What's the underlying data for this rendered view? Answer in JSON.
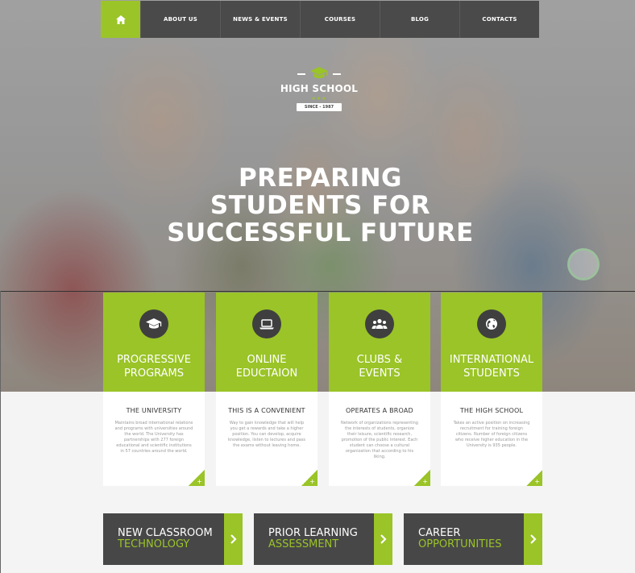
{
  "nav": {
    "home_icon": "home-icon",
    "items": [
      "ABOUT US",
      "NEWS & EVENTS",
      "COURSES",
      "BLOG",
      "CONTACTS"
    ]
  },
  "logo": {
    "name": "HIGH SCHOOL",
    "stars": "★★★",
    "since": "SINCE - 1987"
  },
  "hero": {
    "headline": "PREPARING STUDENTS FOR SUCCESSFUL FUTURE"
  },
  "features": [
    {
      "icon": "graduation-cap-icon",
      "line1": "PROGRESSIVE",
      "line2": "PROGRAMS"
    },
    {
      "icon": "laptop-icon",
      "line1": "ONLINE",
      "line2": "EDUCTAION"
    },
    {
      "icon": "people-icon",
      "line1": "CLUBS &",
      "line2": "EVENTS"
    },
    {
      "icon": "globe-icon",
      "line1": "INTERNATIONAL",
      "line2": "STUDENTS"
    }
  ],
  "cards": [
    {
      "heading": "THE UNIVERSITY",
      "text": "Maintains broad international relations and programs with universities around the world. The University has partnerships with 277 foreign educational and scientific institutions in 57 countries around the world."
    },
    {
      "heading": "THIS IS A CONVENIENT",
      "text": "Way to gain knowledge that will help you get a rewards and take a higher position. You can develop, acquire knowledge, listen to lectures and pass the exams without leaving home."
    },
    {
      "heading": "OPERATES A BROAD",
      "text": "Network of organizations representing the interests of students, organize their leisure, scientific research, promotion of the public interest. Each student can choose a cultural organization that according to his liking."
    },
    {
      "heading": "THE HIGH SCHOOL",
      "text": "Takes an active position on increasing recruitment for training foreign citizens. Number of foreign citizens who receive higher education in the University is 935 people."
    }
  ],
  "card_plus": "+",
  "buttons": [
    {
      "line1": "NEW CLASSROOM",
      "line2": "TECHNOLOGY"
    },
    {
      "line1": "PRIOR LEARNING",
      "line2": "ASSESSMENT"
    },
    {
      "line1": "CAREER",
      "line2": "OPPORTUNITIES"
    }
  ],
  "colors": {
    "accent": "#9ac427",
    "dark": "#474747",
    "nav": "#4a4a4a"
  }
}
